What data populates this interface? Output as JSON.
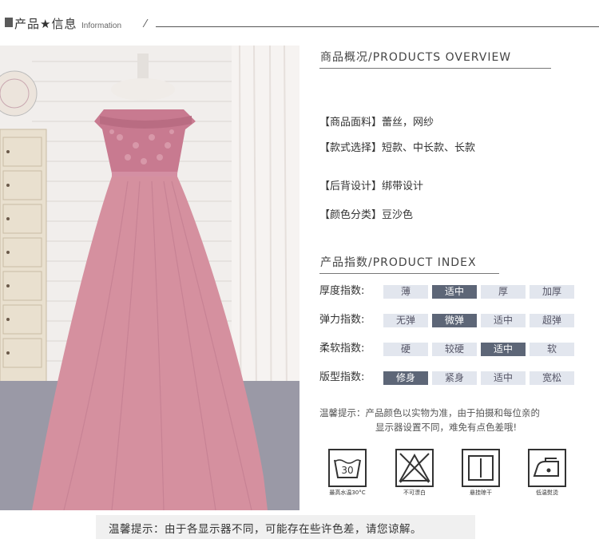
{
  "header": {
    "title": "产品★信息",
    "subtitle": "Information"
  },
  "overview": {
    "heading": "商品概况/PRODUCTS OVERVIEW",
    "rows": [
      {
        "tag": "【商品面料】",
        "value": "蕾丝，网纱"
      },
      {
        "tag": "【款式选择】",
        "value": "短款、中长款、长款"
      },
      {
        "tag": "【后背设计】",
        "value": "绑带设计"
      },
      {
        "tag": "【颜色分类】",
        "value": "豆沙色"
      }
    ]
  },
  "index": {
    "heading": "产品指数/PRODUCT INDEX",
    "rows": [
      {
        "label": "厚度指数:",
        "options": [
          "薄",
          "适中",
          "厚",
          "加厚"
        ],
        "active": 1
      },
      {
        "label": "弹力指数:",
        "options": [
          "无弹",
          "微弹",
          "适中",
          "超弹"
        ],
        "active": 1
      },
      {
        "label": "柔软指数:",
        "options": [
          "硬",
          "较硬",
          "适中",
          "软"
        ],
        "active": 2
      },
      {
        "label": "版型指数:",
        "options": [
          "修身",
          "紧身",
          "适中",
          "宽松"
        ],
        "active": 0
      }
    ]
  },
  "note": {
    "line1": "温馨提示：产品颜色以实物为准，由于拍摄和每位亲的",
    "line2": "显示器设置不同，难免有点色差哦!"
  },
  "care": [
    {
      "icon": "wash-30-icon",
      "number": "30",
      "caption": "最高水温30°C"
    },
    {
      "icon": "no-bleach-icon",
      "caption": "不可漂白"
    },
    {
      "icon": "hang-dry-icon",
      "caption": "悬挂晾干"
    },
    {
      "icon": "low-iron-icon",
      "caption": "低温熨烫"
    }
  ],
  "footer": {
    "text": "温馨提示：由于各显示器不同，可能存在些许色差，请您谅解。"
  },
  "colors": {
    "active_cell": "#5d6677",
    "inactive_cell": "#e2e6ee",
    "dress": "#d28a9e"
  }
}
